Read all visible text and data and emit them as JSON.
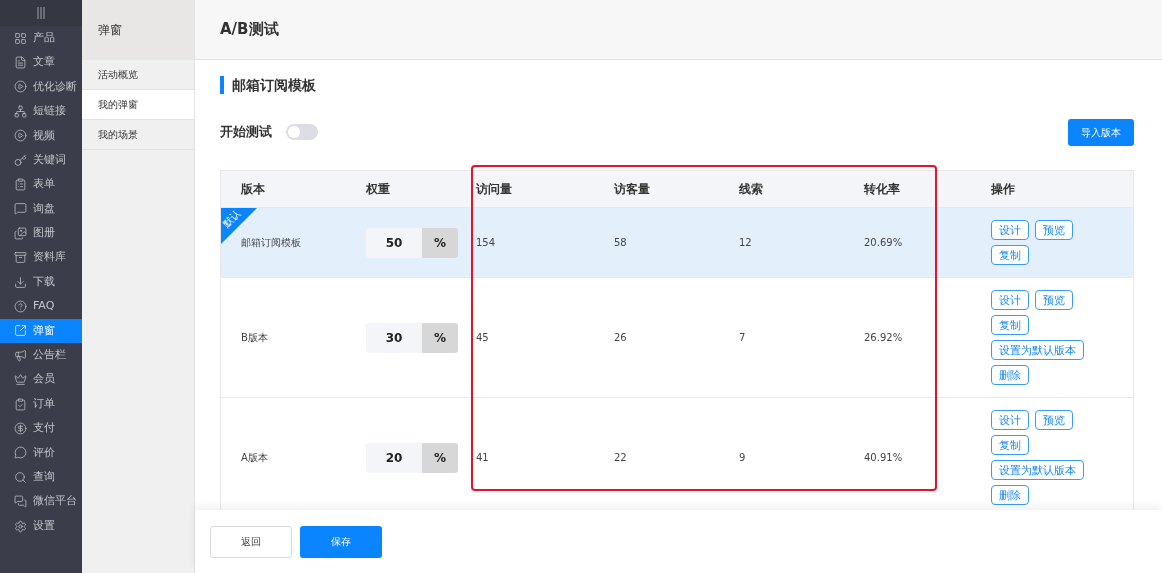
{
  "sidebar": {
    "items": [
      {
        "label": "产品",
        "selected": false
      },
      {
        "label": "文章",
        "selected": false
      },
      {
        "label": "优化诊断",
        "selected": false
      },
      {
        "label": "短链接",
        "selected": false
      },
      {
        "label": "视频",
        "selected": false
      },
      {
        "label": "关键词",
        "selected": false
      },
      {
        "label": "表单",
        "selected": false
      },
      {
        "label": "询盘",
        "selected": false
      },
      {
        "label": "图册",
        "selected": false
      },
      {
        "label": "资料库",
        "selected": false
      },
      {
        "label": "下载",
        "selected": false
      },
      {
        "label": "FAQ",
        "selected": false
      },
      {
        "label": "弹窗",
        "selected": true
      },
      {
        "label": "公告栏",
        "selected": false
      },
      {
        "label": "会员",
        "selected": false
      },
      {
        "label": "订单",
        "selected": false
      },
      {
        "label": "支付",
        "selected": false
      },
      {
        "label": "评价",
        "selected": false
      },
      {
        "label": "查询",
        "selected": false
      },
      {
        "label": "微信平台",
        "selected": false
      },
      {
        "label": "设置",
        "selected": false
      }
    ]
  },
  "subnav": {
    "title": "弹窗",
    "items": [
      {
        "label": "活动概览",
        "selected": false
      },
      {
        "label": "我的弹窗",
        "selected": true
      },
      {
        "label": "我的场景",
        "selected": false
      }
    ]
  },
  "page": {
    "title": "A/B测试",
    "section_title": "邮箱订阅模板",
    "start_test": {
      "label": "开始测试",
      "on": false
    },
    "import_button": "导入版本"
  },
  "table": {
    "columns": [
      "版本",
      "权重",
      "访问量",
      "访客量",
      "线索",
      "转化率",
      "操作"
    ],
    "rows": [
      {
        "version": "邮箱订阅模板",
        "is_default": true,
        "default_tag": "默认",
        "weight": "50",
        "unit": "%",
        "visits": "154",
        "visitors": "58",
        "leads": "12",
        "conversion": "20.69%",
        "actions": [
          "设计",
          "预览",
          "复制"
        ]
      },
      {
        "version": "B版本",
        "is_default": false,
        "weight": "30",
        "unit": "%",
        "visits": "45",
        "visitors": "26",
        "leads": "7",
        "conversion": "26.92%",
        "actions": [
          "设计",
          "预览",
          "复制",
          "设置为默认版本",
          "删除"
        ]
      },
      {
        "version": "A版本",
        "is_default": false,
        "weight": "20",
        "unit": "%",
        "visits": "41",
        "visitors": "22",
        "leads": "9",
        "conversion": "40.91%",
        "actions": [
          "设计",
          "预览",
          "复制",
          "设置为默认版本",
          "删除"
        ]
      }
    ]
  },
  "footer": {
    "back": "返回",
    "save": "保存"
  }
}
